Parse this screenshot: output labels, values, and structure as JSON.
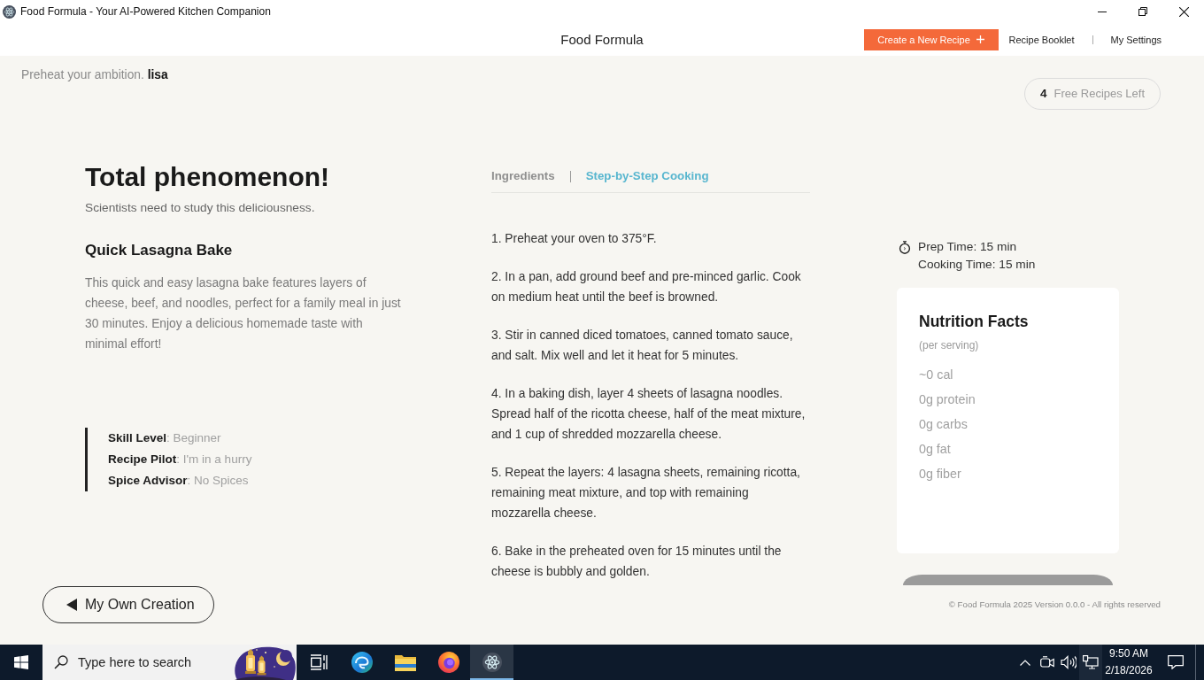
{
  "window": {
    "title": "Food Formula - Your AI-Powered Kitchen Companion"
  },
  "header": {
    "app_name": "Food Formula",
    "create_button": "Create a New Recipe",
    "nav_links": [
      "Recipe Booklet",
      "My Settings"
    ]
  },
  "greeting": {
    "text": "Preheat your ambition. **lisa**"
  },
  "credits": {
    "count": "4",
    "label": "Free Recipes Left"
  },
  "result": {
    "headline": "Total phenomenon!",
    "subline": "Scientists need to study this deliciousness.",
    "recipe_title": "Quick Lasagna Bake",
    "description": "This quick and easy lasagna bake features layers of cheese, beef, and noodles, perfect for a family meal in just 30 minutes. Enjoy a delicious homemade taste with minimal effort!"
  },
  "preferences": [
    "**Skill Level**: Beginner",
    "**Recipe Pilot**: I'm in a hurry",
    "**Spice Advisor**: No Spices"
  ],
  "tabs": [
    {
      "label": "Ingredients",
      "selected": false
    },
    {
      "label": "Step-by-Step Cooking",
      "selected": true
    }
  ],
  "steps": [
    "1. Preheat your oven to 375°F.",
    "2. In a pan, add ground beef and pre-minced garlic. Cook on medium heat until the beef is browned.",
    "3. Stir in canned diced tomatoes, canned tomato sauce, and salt. Mix well and let it heat for 5 minutes.",
    "4. In a baking dish, layer 4 sheets of lasagna noodles. Spread half of the ricotta cheese, half of the meat mixture, and 1 cup of shredded mozzarella cheese.",
    "5. Repeat the layers: 4 lasagna sheets, remaining ricotta, remaining meat mixture, and top with remaining mozzarella cheese.",
    "6. Bake in the preheated oven for 15 minutes until the cheese is bubbly and golden."
  ],
  "times": {
    "prep": "Prep Time: 15 min",
    "cooking": "Cooking Time: 15 min"
  },
  "nutrition": {
    "title": "Nutrition Facts",
    "note": "(per serving)",
    "items": [
      "~0 cal",
      "0g protein",
      "0g carbs",
      "0g fat",
      "0g fiber"
    ]
  },
  "back_button": {
    "label": "My Own Creation"
  },
  "footer": {
    "text": "© Food Formula 2025 Version 0.0.0 - All rights reserved"
  },
  "taskbar": {
    "search_placeholder": "Type here to search",
    "apps": [
      {
        "kind": "task-view",
        "selected": false
      },
      {
        "kind": "wave-browser",
        "selected": false
      },
      {
        "kind": "folder",
        "selected": false
      },
      {
        "kind": "fox-browser",
        "selected": false
      },
      {
        "kind": "atom",
        "selected": true
      }
    ],
    "clock": {
      "time": "9:50 AM",
      "date": "2/18/2026"
    }
  }
}
